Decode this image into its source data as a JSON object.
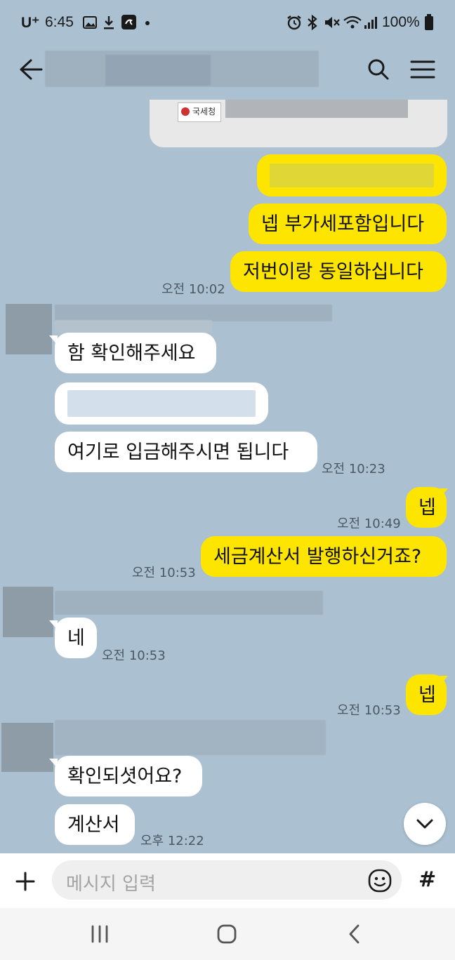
{
  "status_bar": {
    "carrier": "U⁺",
    "time": "6:45",
    "battery": "100%",
    "icons": [
      "gallery-icon",
      "download-icon",
      "app-notification-icon",
      "dot-icon",
      "alarm-icon",
      "bluetooth-icon",
      "mute-icon",
      "wifi-icon",
      "signal-icon",
      "battery-icon"
    ]
  },
  "header": {
    "back_icon": "arrow-left-icon",
    "search_icon": "search-icon",
    "menu_icon": "hamburger-menu-icon"
  },
  "image_thumbnail": {
    "logo_text": "국세청"
  },
  "messages": [
    {
      "from": "me",
      "text": "넵 부가세포함입니다"
    },
    {
      "from": "me",
      "text": "저번이랑 동일하십니다",
      "time": "오전 10:02"
    },
    {
      "from": "other",
      "text": "함 확인해주세요"
    },
    {
      "from": "other",
      "text": "여기로 입금해주시면 됩니다",
      "time": "오전 10:23"
    },
    {
      "from": "me",
      "text": "넵",
      "time": "오전 10:49"
    },
    {
      "from": "me",
      "text": "세금계산서 발행하신거죠?",
      "time": "오전 10:53"
    },
    {
      "from": "other",
      "text": "네",
      "time": "오전 10:53"
    },
    {
      "from": "me",
      "text": "넵",
      "time": "오전 10:53"
    },
    {
      "from": "other",
      "text": "확인되셧어요?"
    },
    {
      "from": "other",
      "text": "계산서",
      "time": "오후 12:22"
    }
  ],
  "input_bar": {
    "add_icon": "plus-icon",
    "placeholder": "메시지 입력",
    "emoji_icon": "emoji-icon",
    "hash_label": "#"
  },
  "nav_bar": {
    "icons": [
      "recent-apps-icon",
      "home-icon",
      "back-nav-icon"
    ]
  },
  "colors": {
    "background": "#abc1d1",
    "my_bubble": "#fee500",
    "other_bubble": "#ffffff"
  }
}
